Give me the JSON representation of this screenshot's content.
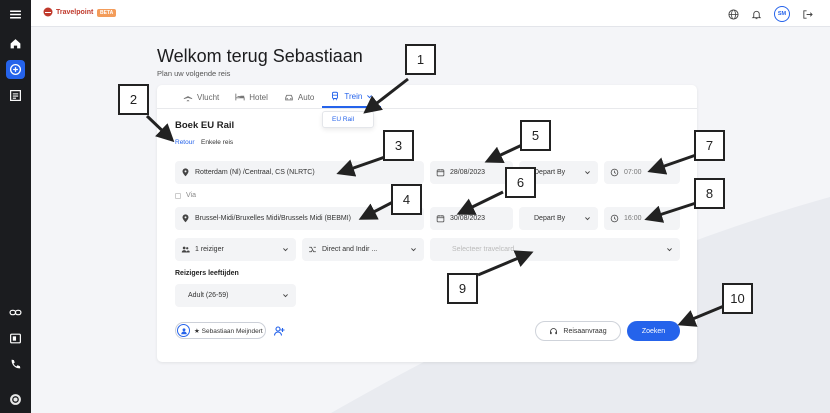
{
  "app": {
    "logo_text": "Travelpoint",
    "beta_badge": "BETA",
    "user_initials": "SM"
  },
  "sidebar": {
    "icons": [
      "menu-icon",
      "home-icon",
      "plus-circle-icon",
      "list-icon",
      "link-icon",
      "contact-card-icon",
      "phone-icon",
      "brand-icon"
    ]
  },
  "header": {
    "icons": [
      "globe-icon",
      "bell-icon",
      "logout-icon"
    ]
  },
  "page": {
    "title": "Welkom terug Sebastiaan",
    "subtitle": "Plan uw volgende reis"
  },
  "tabs": [
    {
      "label": "Vlucht",
      "icon": "plane-icon",
      "active": false
    },
    {
      "label": "Hotel",
      "icon": "hotel-icon",
      "active": false
    },
    {
      "label": "Auto",
      "icon": "car-icon",
      "active": false
    },
    {
      "label": "Trein",
      "icon": "train-icon",
      "active": true
    }
  ],
  "tab_dropdown": {
    "item": "EU Rail"
  },
  "form": {
    "section_title": "Boek EU Rail",
    "trip_type": {
      "retour": "Retour",
      "enkele": "Enkele reis"
    },
    "origin": "Rotterdam (Nl) /Centraal, CS (NLRTC)",
    "depart_date": "28/08/2023",
    "depart_mode": "Depart By",
    "depart_time": "07:00",
    "via_label": "Via",
    "destination": "Brussel-Midi/Bruxelles Midi/Brussels Midi (BEBMI)",
    "return_date": "30/08/2023",
    "return_mode": "Depart By",
    "return_time": "16:00",
    "travellers": "1 reiziger",
    "route_type": "Direct and Indir ...",
    "travel_card_placeholder": "Selecteer travelcard",
    "ages_label": "Reizigers leeftijden",
    "age_option": "Adult (26-59)",
    "traveller_name": "★ Sebastiaan Meijndert",
    "request_button": "Reisaanvraag",
    "search_button": "Zoeken"
  },
  "callouts": [
    "1",
    "2",
    "3",
    "4",
    "5",
    "6",
    "7",
    "8",
    "9",
    "10"
  ],
  "colors": {
    "accent": "#2563eb",
    "sidebar_bg": "#1b1c1f",
    "page_bg": "#f4f5f8",
    "beta": "#f39c5a",
    "logo": "#c0392b"
  }
}
